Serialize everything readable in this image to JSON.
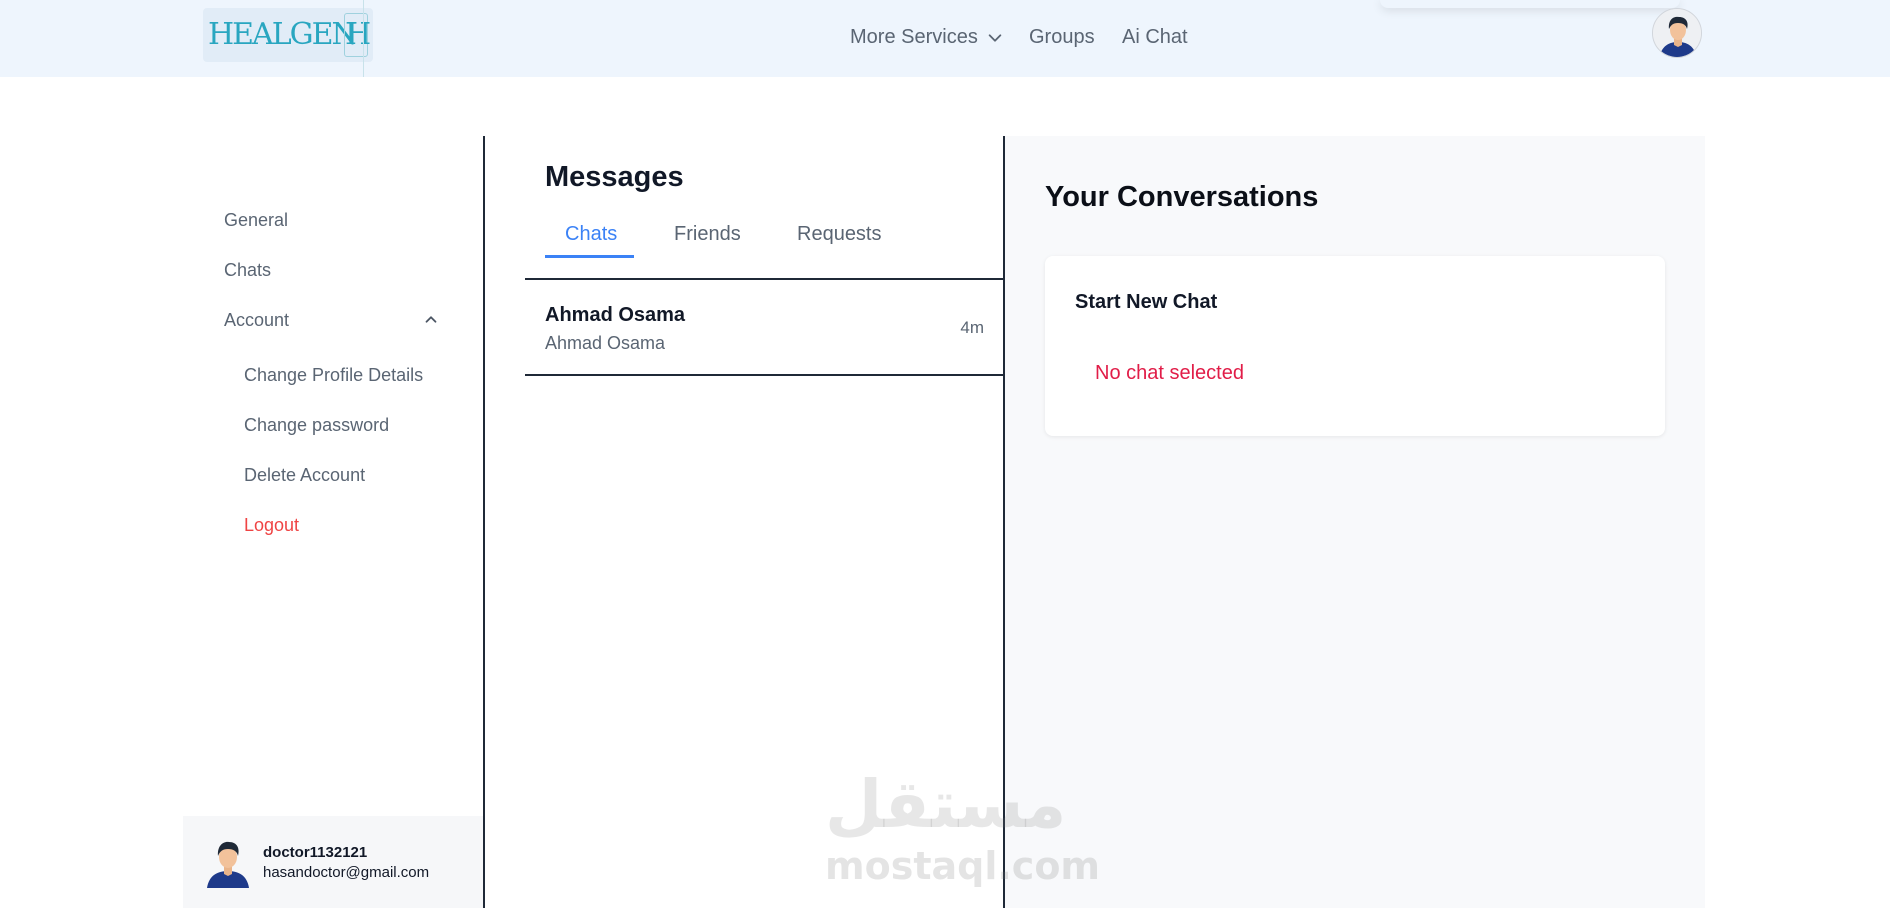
{
  "header": {
    "logo_text": "HEALGEN",
    "logo_mark": "H",
    "nav": {
      "more_services": "More Services",
      "groups": "Groups",
      "ai_chat": "Ai Chat"
    }
  },
  "sidebar": {
    "general": "General",
    "chats": "Chats",
    "account": "Account",
    "account_items": [
      "Change Profile Details",
      "Change password",
      "Delete Account",
      "Logout"
    ],
    "profile": {
      "username": "doctor1132121",
      "email": "hasandoctor@gmail.com"
    }
  },
  "messages": {
    "title": "Messages",
    "tabs": [
      "Chats",
      "Friends",
      "Requests"
    ],
    "active_tab": "Chats",
    "chats": [
      {
        "name": "Ahmad Osama",
        "preview": "Ahmad Osama",
        "time": "4m"
      }
    ]
  },
  "conversation": {
    "title": "Your Conversations",
    "card_title": "Start New Chat",
    "empty_text": "No chat selected"
  },
  "watermark": {
    "arabic": "مستقل",
    "latin": "mostaql.com"
  },
  "colors": {
    "accent": "#3b82f6",
    "danger": "#ef4444",
    "header_bg": "#eef5fd",
    "logo": "#29a6c0"
  },
  "icons": {
    "nav_dropdown": "chevron-down-icon",
    "account_toggle": "chevron-up-icon",
    "avatar": "user-avatar-icon"
  }
}
